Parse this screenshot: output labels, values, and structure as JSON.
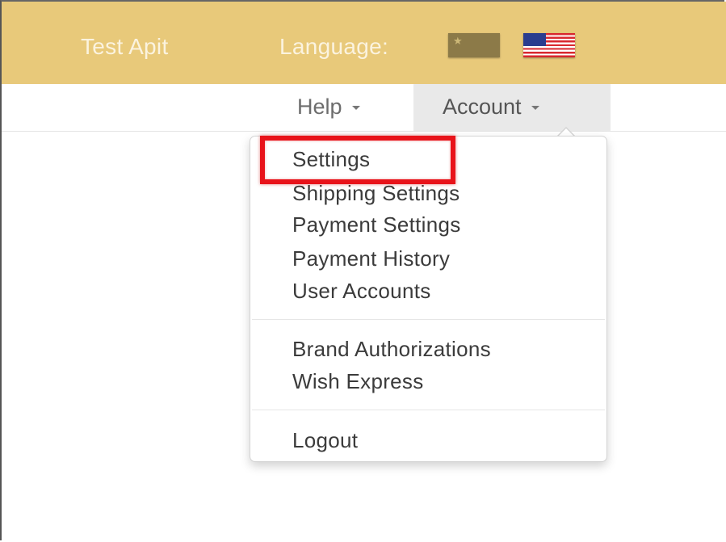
{
  "header": {
    "brand": "Test Apit",
    "language_label": "Language:",
    "flags": [
      {
        "name": "china-flag-icon"
      },
      {
        "name": "us-flag-icon"
      }
    ],
    "bg_color": "#e8c97a"
  },
  "nav": {
    "help_label": "Help",
    "account_label": "Account"
  },
  "account_menu": {
    "group1": [
      "Settings",
      "Shipping Settings",
      "Payment Settings",
      "Payment History",
      "User Accounts"
    ],
    "group2": [
      "Brand Authorizations",
      "Wish Express"
    ],
    "group3": [
      "Logout"
    ]
  },
  "annotation": {
    "highlighted_item": "Settings",
    "color": "#e8131a"
  }
}
